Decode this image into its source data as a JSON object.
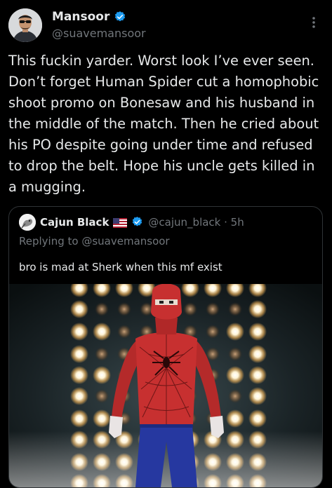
{
  "author": {
    "display_name": "Mansoor",
    "handle": "@suavemansoor",
    "avatar_icon": "profile-photo",
    "verified_icon": "verified-badge-icon",
    "verified_color": "#1d9bf0"
  },
  "more_icon": "more-vertical-icon",
  "tweet": {
    "text": "This fuckin yarder. Worst look I’ve ever seen. Don’t forget Human Spider cut a homophobic shoot promo on Bonesaw and his husband in the middle of the match. Then he cried about his PO despite going under time and refused to drop the belt. Hope his uncle gets killed in a mugging."
  },
  "quoted": {
    "display_name": "Cajun Black",
    "flag_icon": "us-flag-icon",
    "verified_icon": "verified-badge-icon",
    "handle_time": "@cajun_black · 5h",
    "replying": "Replying to @suavemansoor",
    "text": "bro is mad at Sherk when this mf exist",
    "media": "photo of person in red spider costume and blue pants standing in front of stage lights"
  },
  "colors": {
    "background": "#000000",
    "text": "#e7e9ea",
    "secondary": "#71767b",
    "border": "#2f3336",
    "accent": "#1d9bf0"
  }
}
